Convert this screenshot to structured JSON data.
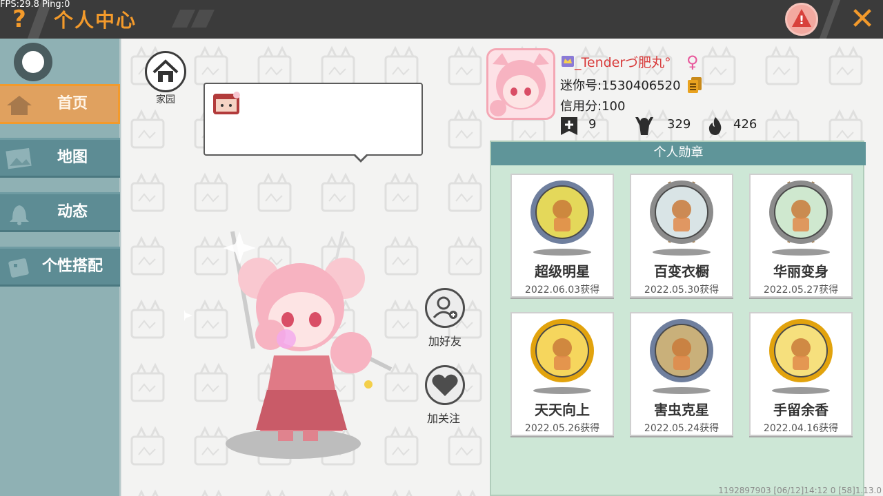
{
  "debug": {
    "fps_text": "FPS:29.8  Ping:0"
  },
  "header": {
    "title": "个人中心",
    "help_icon": "question-mark-icon",
    "report_icon": "warning-triangle-icon",
    "close_icon": "close-x-icon"
  },
  "sidebar": {
    "items": [
      {
        "label": "首页",
        "icon": "house-icon",
        "active": true
      },
      {
        "label": "地图",
        "icon": "map-picture-icon",
        "active": false
      },
      {
        "label": "动态",
        "icon": "bell-icon",
        "active": false
      },
      {
        "label": "个性搭配",
        "icon": "dress-icon",
        "active": false
      }
    ]
  },
  "home": {
    "label": "家园",
    "icon": "house-icon"
  },
  "actions": {
    "add_friend": "加好友",
    "follow": "加关注"
  },
  "profile": {
    "username": "_Tenderづ肥丸°",
    "gender": "♀",
    "mini_id_line": "迷你号:1530406520",
    "credit_line": "信用分:100",
    "stats": [
      {
        "icon": "plus-bookmark-icon",
        "value": "9"
      },
      {
        "icon": "fans-person-icon",
        "value": "329"
      },
      {
        "icon": "flame-icon",
        "value": "426"
      }
    ]
  },
  "medals": {
    "title": "个人勋章",
    "items": [
      {
        "name": "超级明星",
        "date": "2022.06.03获得",
        "ring": "#6f7f9e",
        "inner": "#e4d85a",
        "type": "silver"
      },
      {
        "name": "百变衣橱",
        "date": "2022.05.30获得",
        "ring": "#8c8c8c",
        "inner": "#d9e4e6",
        "type": "stone"
      },
      {
        "name": "华丽变身",
        "date": "2022.05.27获得",
        "ring": "#8c8c8c",
        "inner": "#cfe8cf",
        "type": "stone"
      },
      {
        "name": "天天向上",
        "date": "2022.05.26获得",
        "ring": "#e2a30d",
        "inner": "#f6d65d",
        "type": "gold"
      },
      {
        "name": "害虫克星",
        "date": "2022.05.24获得",
        "ring": "#6f7f9e",
        "inner": "#c9b07a",
        "type": "silver"
      },
      {
        "name": "手留余香",
        "date": "2022.04.16获得",
        "ring": "#e2a30d",
        "inner": "#f6e07d",
        "type": "gold"
      }
    ]
  },
  "footer": {
    "text": "1192897903   [06/12]14:12 0   [58]1.13.0"
  },
  "colors": {
    "accent": "#f39a2b",
    "sidebar": "#8fb1b4",
    "nav": "#5d8c94",
    "panel_header": "#5f9599",
    "panel": "#cde7d6"
  }
}
